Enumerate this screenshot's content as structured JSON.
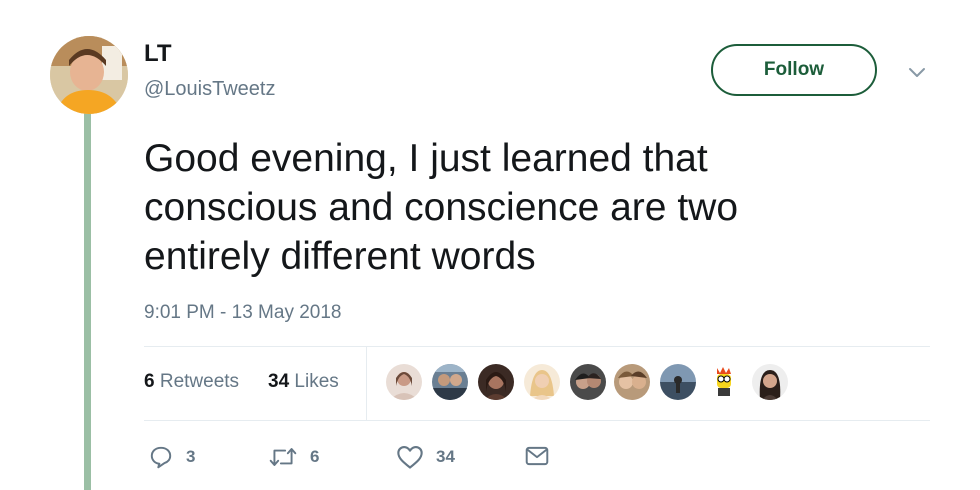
{
  "user": {
    "display_name": "LT",
    "handle": "@LouisTweetz",
    "avatar_icon": "profile-photo"
  },
  "follow_label": "Follow",
  "tweet": {
    "lines": [
      "Good evening, I just learned that",
      "conscious and conscience are two",
      "entirely different words"
    ],
    "timestamp": "9:01 PM - 13 May 2018"
  },
  "stats": {
    "retweets_count": "6",
    "retweets_label": "Retweets",
    "likes_count": "34",
    "likes_label": "Likes"
  },
  "liker_avatars": [
    "liker-1",
    "liker-2",
    "liker-3",
    "liker-4",
    "liker-5",
    "liker-6",
    "liker-7",
    "liker-8",
    "liker-9"
  ],
  "actions": {
    "reply_count": "3",
    "retweet_count": "6",
    "like_count": "34"
  },
  "colors": {
    "follow_green": "#1c5d3a",
    "thread_line": "#9bbfa5",
    "secondary_text": "#657786"
  }
}
